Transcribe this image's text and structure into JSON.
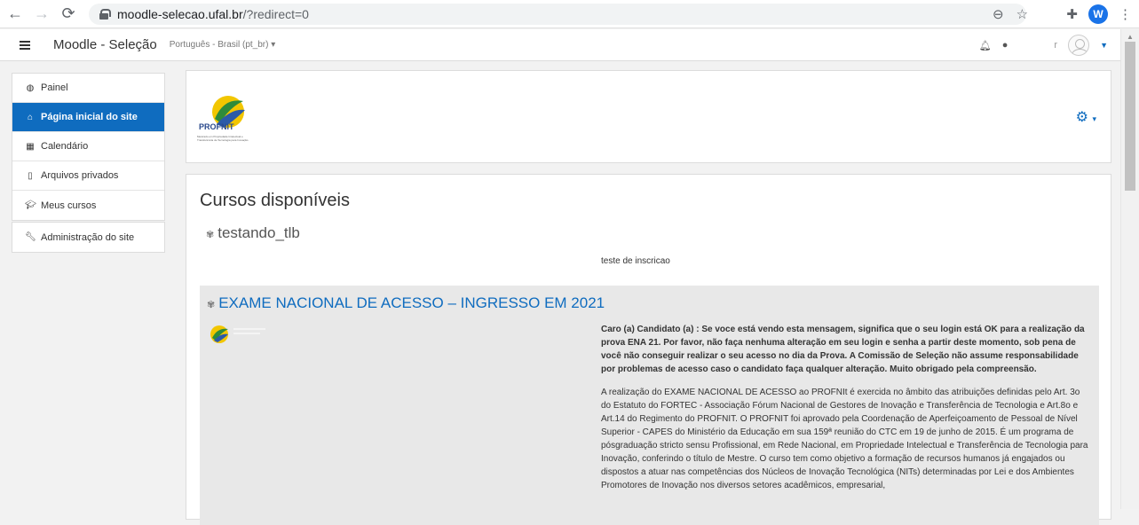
{
  "browser": {
    "url_host": "moodle-selecao.ufal.br",
    "url_path": "/?redirect=0",
    "profile_initial": "W"
  },
  "navbar": {
    "site_name": "Moodle - Seleção",
    "language": "Português - Brasil (pt_br) ▾",
    "user_name_fragment": "r"
  },
  "sidebar": {
    "items": [
      {
        "label": "Painel",
        "icon": "dashboard-icon"
      },
      {
        "label": "Página inicial do site",
        "icon": "home-icon"
      },
      {
        "label": "Calendário",
        "icon": "calendar-icon"
      },
      {
        "label": "Arquivos privados",
        "icon": "file-icon"
      },
      {
        "label": "Meus cursos",
        "icon": "graduation-cap-icon"
      }
    ],
    "admin": {
      "label": "Administração do site",
      "icon": "wrench-icon"
    }
  },
  "header": {
    "logo_text": "PROFNIT",
    "logo_sub": "Mestrado em Propriedade Intelectual e Transferência de Tecnologia para Inovação"
  },
  "main": {
    "section_title": "Cursos disponíveis",
    "courses": [
      {
        "name": "testando_tlb",
        "summary": "teste de inscricao"
      },
      {
        "name": "EXAME NACIONAL DE ACESSO – INGRESSO EM 2021",
        "summary_bold": "Caro (a)  Candidato (a) : Se voce está vendo esta mensagem, significa que o seu login está OK para a realização da prova ENA 21. Por favor, não faça nenhuma alteração em seu login e senha a partir deste momento, sob pena de você não conseguir realizar o seu acesso no dia da Prova. A Comissão de Seleção não assume responsabilidade por problemas de acesso caso o candidato faça qualquer alteração. Muito obrigado pela compreensão.",
        "summary_text": "A realização do EXAME NACIONAL DE ACESSO ao PROFNIt é exercida no âmbito das atribuições definidas pelo Art. 3o do Estatuto do FORTEC - Associação Fórum Nacional de Gestores de Inovação e Transferência de Tecnologia e Art.8o e Art.14 do Regimento do PROFNIT. O PROFNIT foi aprovado pela Coordenação de Aperfeiçoamento de Pessoal de Nível Superior - CAPES do Ministério da Educação em sua 159ª reunião do CTC em 19 de junho de 2015. É um programa de pósgraduação stricto sensu Profissional, em Rede Nacional, em Propriedade Intelectual e Transferência de Tecnologia para Inovação, conferindo o título de Mestre. O curso tem como objetivo a formação de recursos humanos já engajados ou dispostos a atuar nas competências dos Núcleos de Inovação Tecnológica (NITs) determinadas por Lei e dos Ambientes Promotores de Inovação nos diversos setores acadêmicos, empresarial,"
      }
    ]
  },
  "colors": {
    "accent": "#0f6cbf",
    "sidebar_bg": "#f2f2f2"
  }
}
